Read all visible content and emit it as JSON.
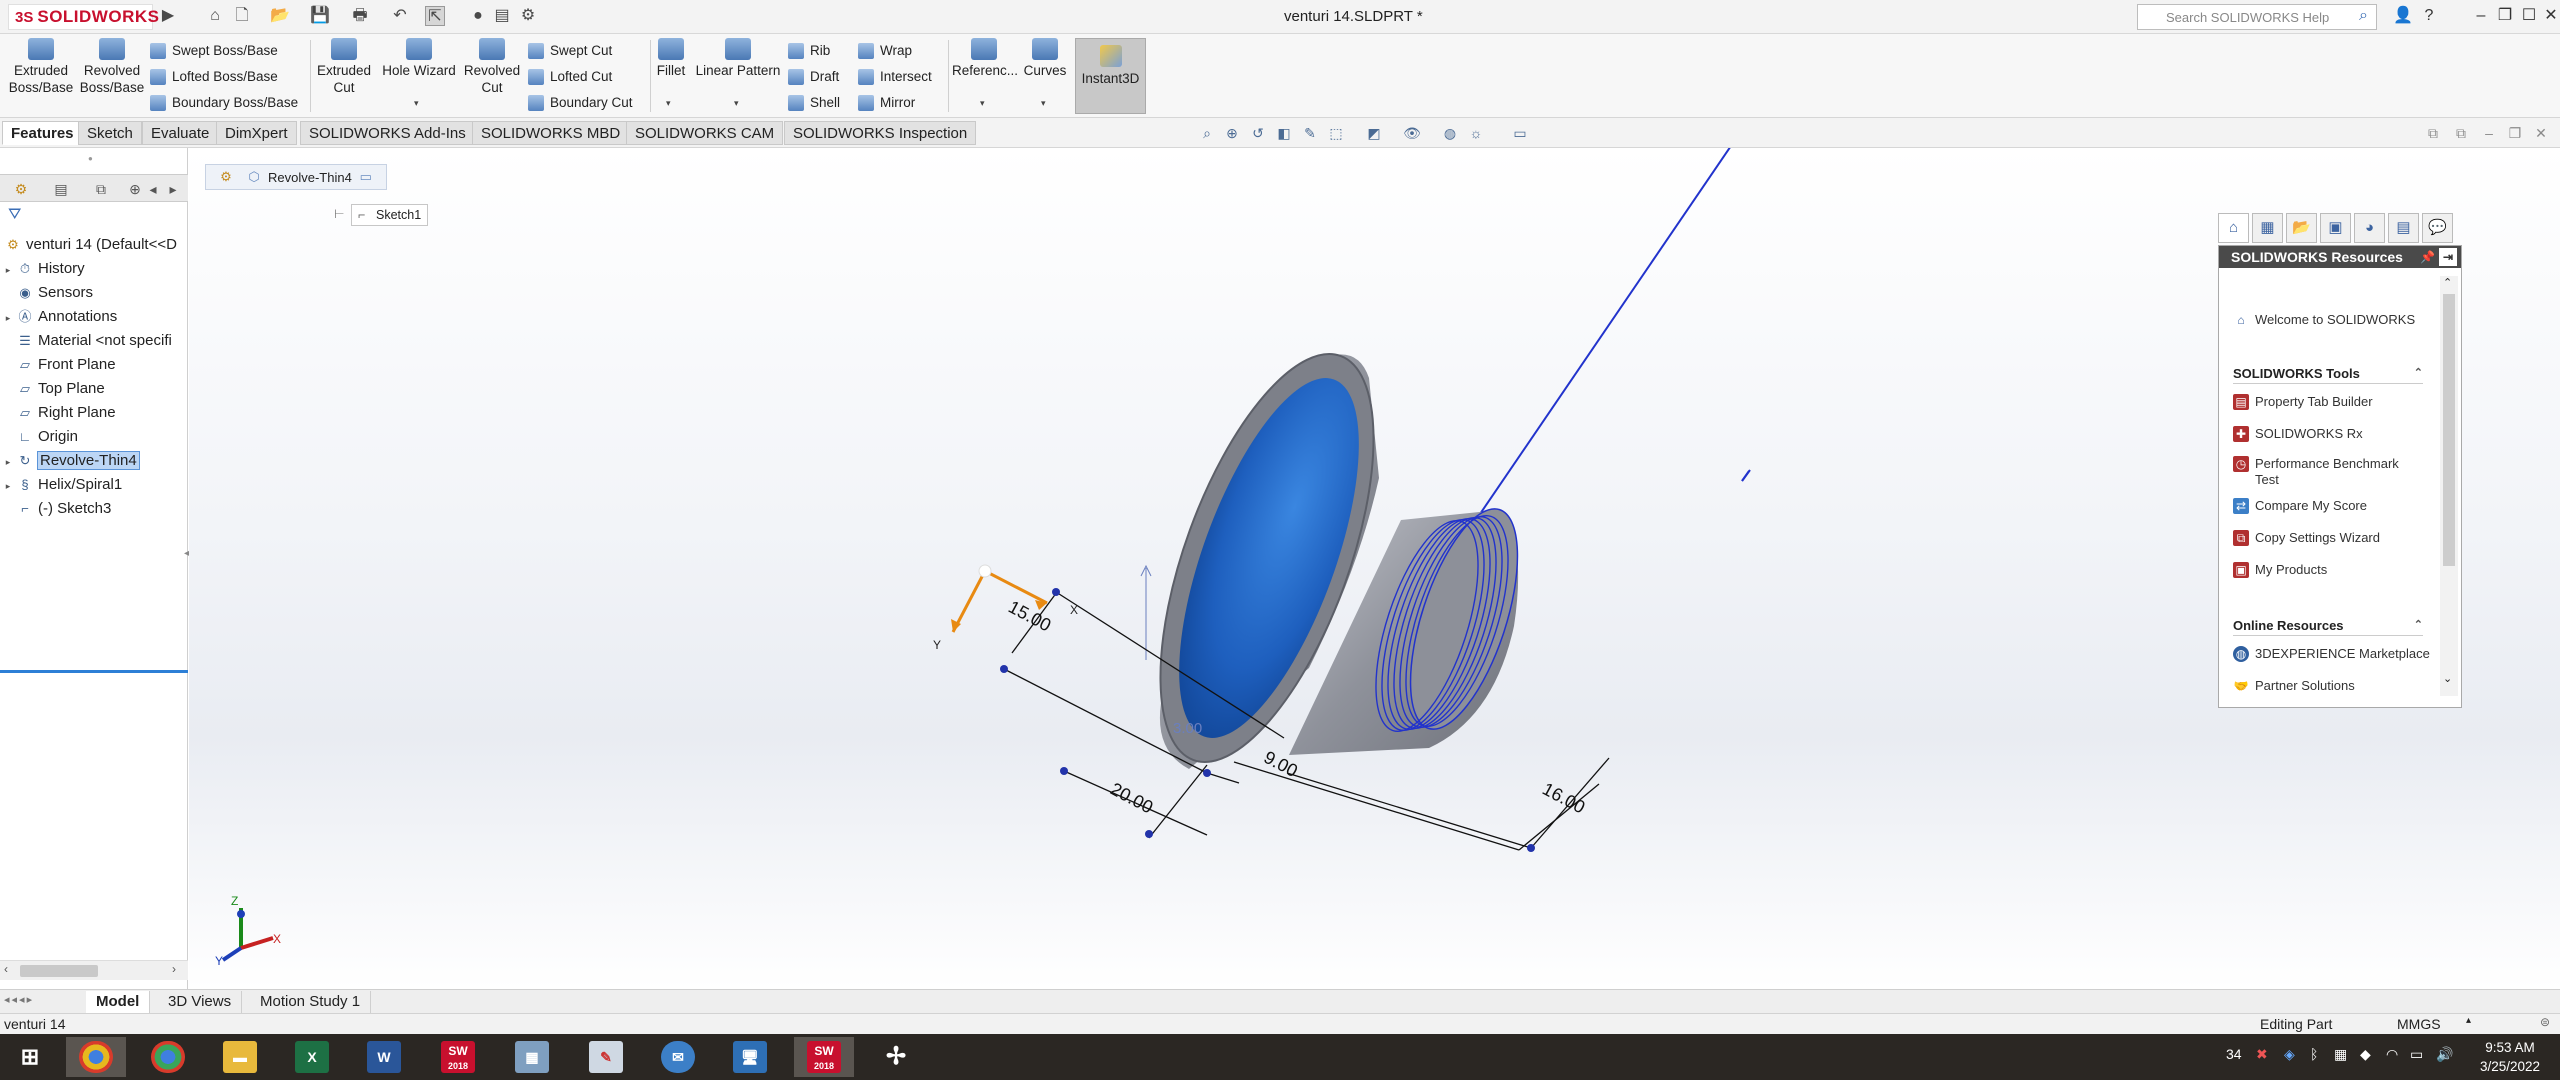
{
  "app": {
    "logo_prefix": "3S",
    "logo_name": "SOLIDWORKS",
    "doc_title": "venturi 14.SLDPRT *",
    "search_placeholder": "Search SOLIDWORKS Help"
  },
  "ribbon": {
    "extruded_boss": "Extruded Boss/Base",
    "revolved_boss": "Revolved Boss/Base",
    "swept_boss": "Swept Boss/Base",
    "lofted_boss": "Lofted Boss/Base",
    "boundary_boss": "Boundary Boss/Base",
    "extruded_cut": "Extruded Cut",
    "hole_wizard": "Hole Wizard",
    "revolved_cut": "Revolved Cut",
    "swept_cut": "Swept Cut",
    "lofted_cut": "Lofted Cut",
    "boundary_cut": "Boundary Cut",
    "fillet": "Fillet",
    "linear_pattern": "Linear Pattern",
    "rib": "Rib",
    "draft": "Draft",
    "shell": "Shell",
    "wrap": "Wrap",
    "intersect": "Intersect",
    "mirror": "Mirror",
    "reference": "Referenc...",
    "curves": "Curves",
    "instant3d": "Instant3D"
  },
  "command_tabs": [
    "Features",
    "Sketch",
    "Evaluate",
    "DimXpert",
    "SOLIDWORKS Add-Ins",
    "SOLIDWORKS MBD",
    "SOLIDWORKS CAM",
    "SOLIDWORKS Inspection"
  ],
  "tree": {
    "root": "venturi 14  (Default<<D",
    "items": [
      {
        "label": "History",
        "icon": "history-icon",
        "expandable": true
      },
      {
        "label": "Sensors",
        "icon": "sensor-icon",
        "expandable": false
      },
      {
        "label": "Annotations",
        "icon": "annotations-icon",
        "expandable": true
      },
      {
        "label": "Material <not specifi",
        "icon": "material-icon",
        "expandable": false
      },
      {
        "label": "Front Plane",
        "icon": "plane-icon",
        "expandable": false
      },
      {
        "label": "Top Plane",
        "icon": "plane-icon",
        "expandable": false
      },
      {
        "label": "Right Plane",
        "icon": "plane-icon",
        "expandable": false
      },
      {
        "label": "Origin",
        "icon": "origin-icon",
        "expandable": false
      },
      {
        "label": "Revolve-Thin4",
        "icon": "revolve-icon",
        "expandable": true,
        "selected": true
      },
      {
        "label": "Helix/Spiral1",
        "icon": "helix-icon",
        "expandable": true
      },
      {
        "label": "(-) Sketch3",
        "icon": "sketch-icon",
        "expandable": false
      }
    ]
  },
  "viewport": {
    "breadcrumb_feature": "Revolve-Thin4",
    "breadcrumb_sketch": "Sketch1",
    "dimensions": [
      "15.00",
      "20.00",
      "9.00",
      "16.00",
      "3.00"
    ],
    "triad_x": "X",
    "triad_y": "Y",
    "axis_x": "X",
    "axis_y": "Y",
    "axis_z": "Z"
  },
  "taskpane": {
    "title": "SOLIDWORKS Resources",
    "welcome": "Welcome to SOLIDWORKS",
    "tools_header": "SOLIDWORKS Tools",
    "tools": [
      "Property Tab Builder",
      "SOLIDWORKS Rx",
      "Performance Benchmark Test",
      "Compare My Score",
      "Copy Settings Wizard",
      "My Products"
    ],
    "online_header": "Online Resources",
    "online": [
      "3DEXPERIENCE Marketplace",
      "Partner Solutions"
    ]
  },
  "bottom_tabs": [
    "Model",
    "3D Views",
    "Motion Study 1"
  ],
  "status": {
    "left": "venturi 14",
    "mode": "Editing Part",
    "units": "MMGS"
  },
  "taskbar": {
    "apps": [
      "start",
      "chrome",
      "chrome-profile",
      "file-explorer",
      "excel",
      "word",
      "solidworks-2018",
      "calculator",
      "paint",
      "mail",
      "remote-desktop",
      "solidworks-2018-active",
      "pinwheel"
    ],
    "sw_label": "2018",
    "tray_temp": "34",
    "time": "9:53 AM",
    "date": "3/25/2022"
  },
  "colors": {
    "accent": "#c8102e",
    "selection": "#bcd6f5",
    "model_blue": "#1f66c9",
    "part_gray": "#9a9ca4"
  }
}
